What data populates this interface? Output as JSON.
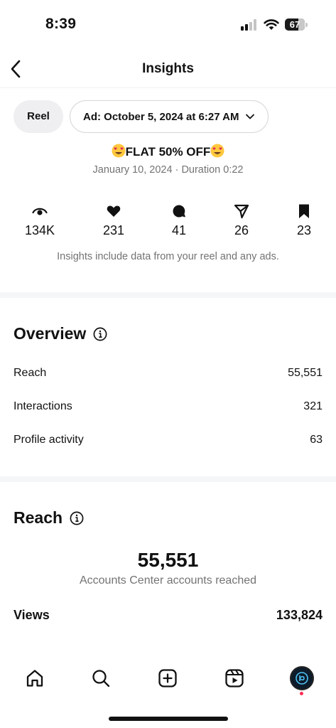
{
  "status_bar": {
    "time": "8:39",
    "battery": "67",
    "battery_level": 0.67
  },
  "header": {
    "title": "Insights"
  },
  "filters": {
    "type_chip": "Reel",
    "ad_chip": "Ad: October 5, 2024 at 6:27 AM"
  },
  "post": {
    "title": "FLAT 50% OFF",
    "subtitle": "January 10, 2024 · Duration 0:22"
  },
  "metrics": [
    {
      "icon": "eye-icon",
      "value": "134K"
    },
    {
      "icon": "heart-icon",
      "value": "231"
    },
    {
      "icon": "comment-icon",
      "value": "41"
    },
    {
      "icon": "share-icon",
      "value": "26"
    },
    {
      "icon": "bookmark-icon",
      "value": "23"
    }
  ],
  "metrics_note": "Insights include data from your reel and any ads.",
  "overview": {
    "title": "Overview",
    "rows": [
      {
        "label": "Reach",
        "value": "55,551"
      },
      {
        "label": "Interactions",
        "value": "321"
      },
      {
        "label": "Profile activity",
        "value": "63"
      }
    ]
  },
  "reach": {
    "title": "Reach",
    "total": "55,551",
    "caption": "Accounts Center accounts reached",
    "views_label": "Views",
    "views_value": "133,824"
  },
  "tabbar": [
    "home-icon",
    "search-icon",
    "create-icon",
    "reels-icon",
    "profile-avatar"
  ]
}
